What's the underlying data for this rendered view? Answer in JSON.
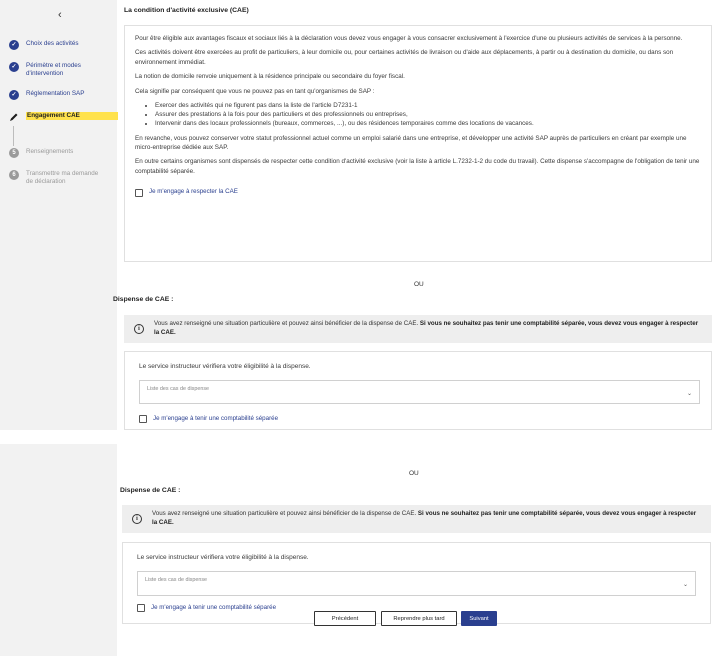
{
  "sidebar": {
    "back_icon": "chevron-left-icon",
    "steps": [
      {
        "label": "Choix des activités",
        "state": "done"
      },
      {
        "label": "Périmètre et modes d'intervention",
        "state": "done"
      },
      {
        "label": "Réglementation SAP",
        "state": "done"
      },
      {
        "label": "Engagement CAE",
        "state": "active"
      },
      {
        "label": "Renseignements",
        "state": "todo",
        "number": "5"
      },
      {
        "label": "Transmettre ma demande de déclaration",
        "state": "todo",
        "number": "6"
      }
    ]
  },
  "cae": {
    "title": "La condition d'activité exclusive (CAE)",
    "p1": "Pour être éligible aux avantages fiscaux et sociaux liés à la déclaration vous devez vous engager à vous consacrer exclusivement à l'exercice d'une ou plusieurs activités de services à la personne.",
    "p2": "Ces activités doivent être exercées au profit de particuliers, à leur domicile ou, pour certaines activités de livraison ou d'aide aux déplacements, à partir ou à destination du domicile, ou dans son environnement immédiat.",
    "p3": "La notion de domicile renvoie uniquement à la résidence principale ou secondaire du foyer fiscal.",
    "p4": "Cela signifie par conséquent que vous ne pouvez pas en tant qu'organismes de SAP :",
    "bullets": [
      "Exercer des activités qui ne figurent pas dans la liste de l'article D7231-1",
      "Assurer des prestations à la fois pour des particuliers et des professionnels ou entreprises,",
      "Intervenir dans des locaux professionnels (bureaux, commerces, ...), ou des résidences temporaires comme des locations de vacances."
    ],
    "p5": "En revanche, vous pouvez conserver votre statut professionnel actuel comme un emploi salarié dans une entreprise, et développer une activité SAP auprès de particuliers en créant par exemple une micro-entreprise dédiée aux SAP.",
    "p6": "En outre certains organismes sont dispensés de respecter cette condition d'activité exclusive (voir la liste à article L.7232-1-2 du code du travail). Cette dispense s'accompagne de l'obligation de tenir une comptabilité séparée.",
    "checkbox_label": "Je m'engage à respecter la CAE"
  },
  "ou": "OU",
  "dispense": {
    "title": "Dispense de CAE :",
    "alert_text": "Vous avez renseigné une situation particulière et pouvez ainsi bénéficier de la dispense de CAE.",
    "alert_bold": "Si vous ne souhaitez pas tenir une comptabilité séparée, vous devez vous engager à respecter la CAE.",
    "intro": "Le service instructeur vérifiera votre éligibilité à la dispense.",
    "select_placeholder": "Liste des cas de dispense",
    "checkbox_label": "Je m'engage à tenir une comptabilité séparée"
  },
  "buttons": {
    "previous": "Précédent",
    "later": "Reprendre plus tard",
    "next": "Suivant"
  },
  "colors": {
    "primary": "#2a3f8f",
    "highlight": "#ffe24d",
    "sidebar_bg": "#f2f2f2",
    "alert_bg": "#eeeeee"
  }
}
